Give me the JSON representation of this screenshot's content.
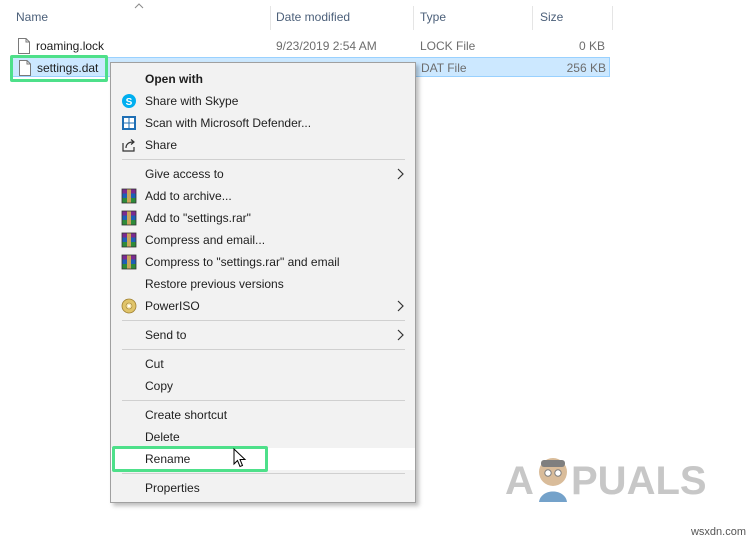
{
  "columns": {
    "name": "Name",
    "date_modified": "Date modified",
    "type": "Type",
    "size": "Size"
  },
  "files": [
    {
      "name": "roaming.lock",
      "date_modified": "9/23/2019 2:54 AM",
      "type": "LOCK File",
      "size": "0 KB",
      "selected": false
    },
    {
      "name": "settings.dat",
      "date_modified": "",
      "type": "DAT File",
      "size": "256 KB",
      "selected": true
    }
  ],
  "context_menu": {
    "items": [
      {
        "label": "Open with",
        "icon": "none",
        "bold": true
      },
      {
        "label": "Share with Skype",
        "icon": "skype-icon"
      },
      {
        "label": "Scan with Microsoft Defender...",
        "icon": "defender-shield-icon"
      },
      {
        "label": "Share",
        "icon": "share-icon"
      },
      {
        "label": "Give access to",
        "icon": "none",
        "submenu": true
      },
      {
        "label": "Add to archive...",
        "icon": "winrar-icon"
      },
      {
        "label": "Add to \"settings.rar\"",
        "icon": "winrar-icon"
      },
      {
        "label": "Compress and email...",
        "icon": "winrar-icon"
      },
      {
        "label": "Compress to \"settings.rar\" and email",
        "icon": "winrar-icon"
      },
      {
        "label": "Restore previous versions",
        "icon": "none"
      },
      {
        "label": "PowerISO",
        "icon": "poweriso-disc-icon",
        "submenu": true
      },
      {
        "label": "Send to",
        "icon": "none",
        "submenu": true
      },
      {
        "label": "Cut",
        "icon": "none"
      },
      {
        "label": "Copy",
        "icon": "none"
      },
      {
        "label": "Create shortcut",
        "icon": "none"
      },
      {
        "label": "Delete",
        "icon": "none"
      },
      {
        "label": "Rename",
        "icon": "none",
        "hovered": true,
        "highlighted": true
      },
      {
        "label": "Properties",
        "icon": "none"
      }
    ]
  },
  "watermark": {
    "logo_text": "APPUALS",
    "site": "wsxdn.com"
  },
  "colors": {
    "selection_bg": "#cce8ff",
    "highlight_box": "#4ee08a",
    "menu_bg": "#f2f2f2"
  }
}
